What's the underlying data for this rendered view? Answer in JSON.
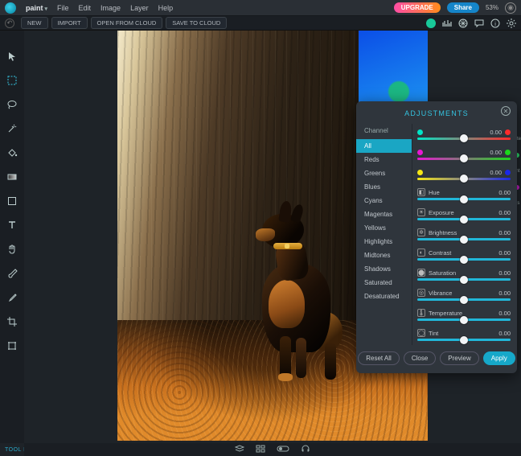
{
  "app": {
    "name": "paint"
  },
  "menu": {
    "file": "File",
    "edit": "Edit",
    "image": "Image",
    "layer": "Layer",
    "help": "Help"
  },
  "topRight": {
    "upgrade": "UPGRADE",
    "share": "Share",
    "percent": "53%"
  },
  "toolbar": {
    "new": "NEW",
    "import": "IMPORT",
    "openFromCloud": "OPEN FROM CLOUD",
    "saveToCloud": "SAVE TO CLOUD"
  },
  "toolInfo": "TOOL INFO",
  "panel": {
    "title": "ADJUSTMENTS",
    "channelHeader": "Channel",
    "channels": [
      "All",
      "Reds",
      "Greens",
      "Blues",
      "Cyans",
      "Magentas",
      "Yellows",
      "Highlights",
      "Midtones",
      "Shadows",
      "Saturated",
      "Desaturated"
    ],
    "colorSliders": [
      {
        "left": "#00e4c6",
        "right": "#ff2b2b",
        "value": "0.00",
        "thumb": 50
      },
      {
        "left": "#e818d3",
        "right": "#1bd61b",
        "value": "0.00",
        "thumb": 50
      },
      {
        "left": "#f5e615",
        "right": "#1a28e8",
        "value": "0.00",
        "thumb": 50
      }
    ],
    "adjustSliders": [
      {
        "icon": "hue-icon",
        "label": "Hue",
        "value": "0.00",
        "thumb": 50
      },
      {
        "icon": "exposure-icon",
        "label": "Exposure",
        "value": "0.00",
        "thumb": 50
      },
      {
        "icon": "brightness-icon",
        "label": "Brightness",
        "value": "0.00",
        "thumb": 50
      },
      {
        "icon": "contrast-icon",
        "label": "Contrast",
        "value": "0.00",
        "thumb": 50
      },
      {
        "icon": "saturation-icon",
        "label": "Saturation",
        "value": "0.00",
        "thumb": 50
      },
      {
        "icon": "vibrance-icon",
        "label": "Vibrance",
        "value": "0.00",
        "thumb": 50
      },
      {
        "icon": "temperature-icon",
        "label": "Temperature",
        "value": "0.00",
        "thumb": 50
      },
      {
        "icon": "tint-icon",
        "label": "Tint",
        "value": "0.00",
        "thumb": 50
      }
    ],
    "buttons": {
      "resetAll": "Reset All",
      "close": "Close",
      "preview": "Preview",
      "apply": "Apply"
    }
  },
  "rightStrip": {
    "labels": [
      "ste",
      "ht",
      "ts"
    ]
  }
}
